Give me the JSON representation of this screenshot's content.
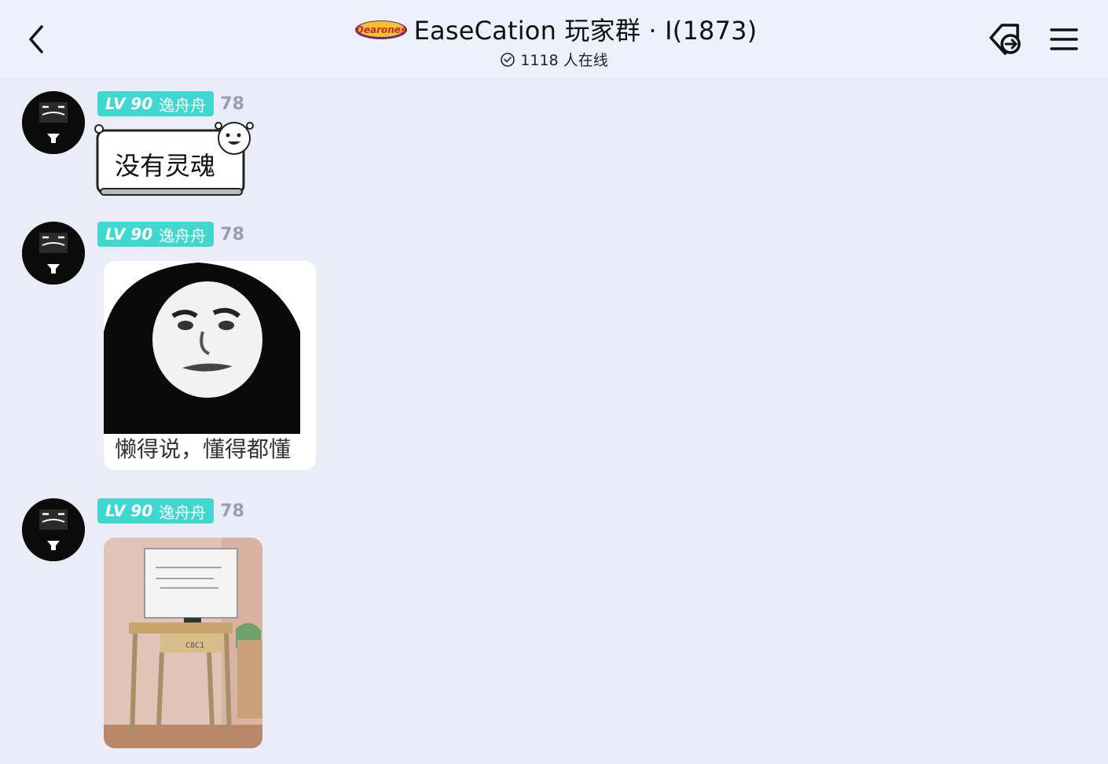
{
  "header": {
    "logo_text": "Dearones",
    "title": "EaseCation 玩家群 · I(1873)",
    "online": "1118 人在线"
  },
  "messages": [
    {
      "level": "LV 90",
      "nickname": "逸舟舟",
      "uid": "78",
      "type": "sticker-text",
      "text": "没有灵魂"
    },
    {
      "level": "LV 90",
      "nickname": "逸舟舟",
      "uid": "78",
      "type": "meme-image",
      "caption": "懒得说，懂得都懂"
    },
    {
      "level": "LV 90",
      "nickname": "逸舟舟",
      "uid": "78",
      "type": "photo",
      "desk_label": "C8C1"
    }
  ],
  "icons": {
    "back": "chevron-left-icon",
    "online": "check-circle-icon",
    "share": "tag-share-icon",
    "menu": "hamburger-menu-icon"
  },
  "colors": {
    "badge": "#3ed8d0",
    "background": "#eaedf7",
    "header": "#eef1fb"
  }
}
